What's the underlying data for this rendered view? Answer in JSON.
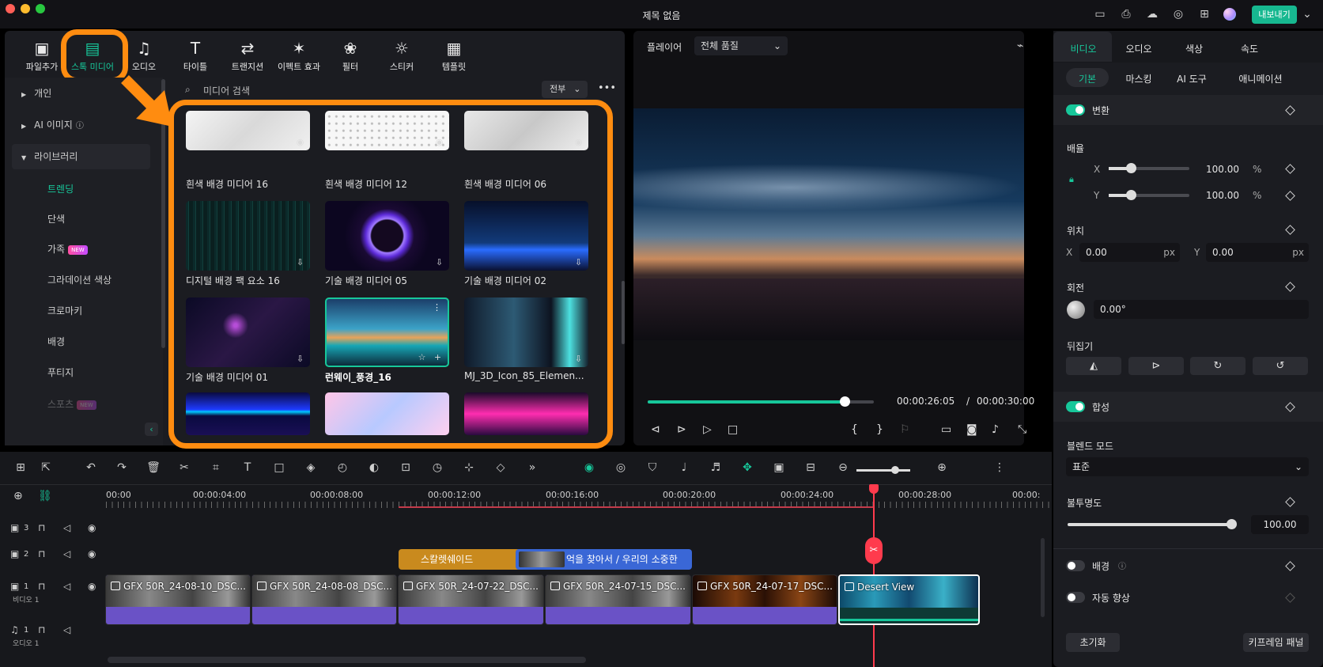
{
  "window": {
    "title": "제목 없음",
    "export_label": "내보내기"
  },
  "colors": {
    "accent": "#17c79a",
    "highlight": "#ff8c10",
    "purple_clip": "#6a52c6"
  },
  "toolbar": [
    {
      "label": "파일추가",
      "icon": "import-media-icon"
    },
    {
      "label": "스톡 미디어",
      "icon": "stock-media-icon"
    },
    {
      "label": "오디오",
      "icon": "music-note-icon"
    },
    {
      "label": "타이틀",
      "icon": "text-t-icon"
    },
    {
      "label": "트랜지션",
      "icon": "transition-icon"
    },
    {
      "label": "이펙트 효과",
      "icon": "effects-sparkle-icon"
    },
    {
      "label": "필터",
      "icon": "filter-icon"
    },
    {
      "label": "스티커",
      "icon": "sticker-icon"
    },
    {
      "label": "템플릿",
      "icon": "template-icon"
    }
  ],
  "sidebar": {
    "items": [
      {
        "label": "개인"
      },
      {
        "label": "AI 이미지"
      },
      {
        "label": "라이브러리"
      }
    ],
    "sub_items": [
      {
        "label": "트렌딩",
        "active": true
      },
      {
        "label": "단색"
      },
      {
        "label": "가족",
        "badge": "NEW"
      },
      {
        "label": "그라데이션 색상"
      },
      {
        "label": "크로마키"
      },
      {
        "label": "배경"
      },
      {
        "label": "푸티지"
      },
      {
        "label": "스포츠",
        "badge": "NEW"
      }
    ]
  },
  "search": {
    "placeholder": "미디어 검색",
    "filter": "전부"
  },
  "media": [
    {
      "label": "흰색 배경 미디어 16"
    },
    {
      "label": "흰색 배경 미디어 12"
    },
    {
      "label": "흰색 배경 미디어 06"
    },
    {
      "label": "디지털 배경 팩 요소 16"
    },
    {
      "label": "기술 배경 미디어 05"
    },
    {
      "label": "기술 배경 미디어 02"
    },
    {
      "label": "기술 배경 미디어 01"
    },
    {
      "label": "런웨이_풍경_16"
    },
    {
      "label": "MJ_3D_Icon_85_Elemen..."
    }
  ],
  "player": {
    "label": "플레이어",
    "quality": "전체 품질",
    "current_time": "00:00:26:05",
    "separator": "/",
    "total_time": "00:00:30:00",
    "progress": 0.87
  },
  "inspector": {
    "tabs": [
      "비디오",
      "오디오",
      "색상",
      "속도"
    ],
    "subtabs": [
      "기본",
      "마스킹",
      "AI 도구",
      "애니메이션"
    ],
    "transform_label": "변환",
    "scale_label": "배율",
    "scale_x": {
      "axis": "X",
      "value": "100.00",
      "unit": "%"
    },
    "scale_y": {
      "axis": "Y",
      "value": "100.00",
      "unit": "%"
    },
    "position_label": "위치",
    "pos_x": {
      "axis": "X",
      "value": "0.00",
      "unit": "px"
    },
    "pos_y": {
      "axis": "Y",
      "value": "0.00",
      "unit": "px"
    },
    "rotation_label": "회전",
    "rotation_value": "0.00°",
    "flip_label": "뒤집기",
    "composite_label": "합성",
    "blend_label": "블렌드 모드",
    "blend_value": "표준",
    "opacity_label": "불투명도",
    "opacity_value": "100.00",
    "background_label": "배경",
    "auto_enhance_label": "자동 향상",
    "reset_label": "초기화",
    "keyframe_label": "키프레임 패널"
  },
  "timeline": {
    "ruler": [
      "00:00",
      "00:00:04:00",
      "00:00:08:00",
      "00:00:12:00",
      "00:00:16:00",
      "00:00:20:00",
      "00:00:24:00",
      "00:00:28:00",
      "00:00:"
    ],
    "tracks": [
      {
        "num": "3",
        "type": "video"
      },
      {
        "num": "2",
        "type": "video"
      },
      {
        "num": "1",
        "type": "video",
        "name": "비디오 1"
      },
      {
        "num": "1",
        "type": "audio",
        "name": "오디오 1"
      }
    ],
    "title_clips": [
      {
        "label": "스칼렛쉐이드"
      },
      {
        "label": "억을 찾아서 / 우리의 소중한"
      }
    ],
    "clips": [
      {
        "label": "GFX 50R_24-08-10_DSC..."
      },
      {
        "label": "GFX 50R_24-08-08_DSC..."
      },
      {
        "label": "GFX 50R_24-07-22_DSC..."
      },
      {
        "label": "GFX 50R_24-07-15_DSC..."
      },
      {
        "label": "GFX 50R_24-07-17_DSC..."
      },
      {
        "label": "Desert View"
      }
    ]
  }
}
